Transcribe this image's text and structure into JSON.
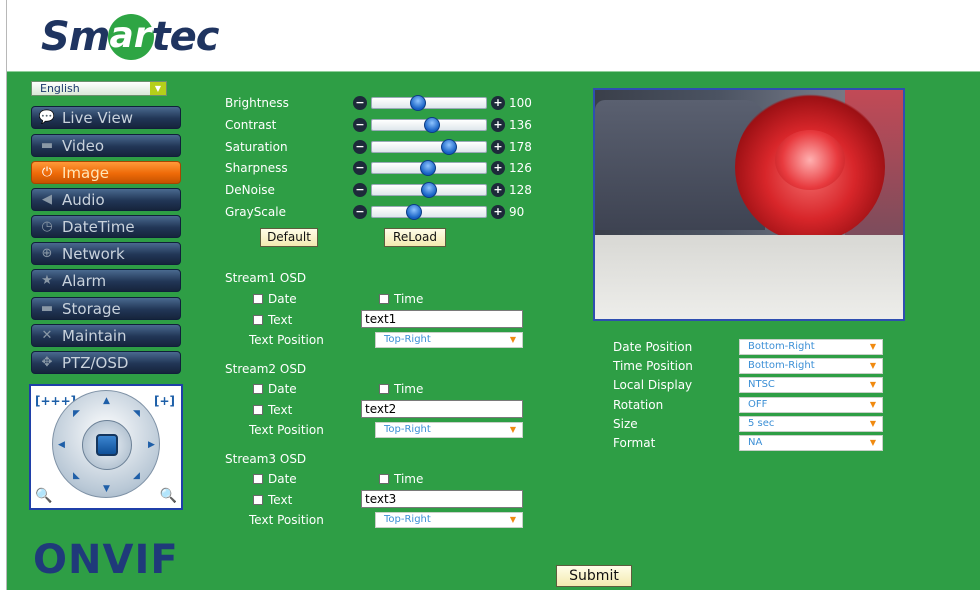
{
  "brand": {
    "logo_pre": "Sm",
    "logo_ball": "ar",
    "logo_post": "tec",
    "onvif": "ONVIF"
  },
  "language": {
    "selected": "English"
  },
  "nav": [
    {
      "label": "Live View",
      "icon": "chat-bubble-icon",
      "active": false
    },
    {
      "label": "Video",
      "icon": "camera-icon",
      "active": false
    },
    {
      "label": "Image",
      "icon": "power-icon",
      "active": true
    },
    {
      "label": "Audio",
      "icon": "speaker-icon",
      "active": false
    },
    {
      "label": "DateTime",
      "icon": "clock-icon",
      "active": false
    },
    {
      "label": "Network",
      "icon": "globe-icon",
      "active": false
    },
    {
      "label": "Alarm",
      "icon": "star-icon",
      "active": false
    },
    {
      "label": "Storage",
      "icon": "drive-icon",
      "active": false
    },
    {
      "label": "Maintain",
      "icon": "tools-icon",
      "active": false
    },
    {
      "label": "PTZ/OSD",
      "icon": "move-arrows-icon",
      "active": false
    }
  ],
  "ptz": {
    "zoom_out": "[+++]",
    "zoom_in": "[+]"
  },
  "image": {
    "sliders": [
      {
        "label": "Brightness",
        "value": "100",
        "level": 0.39
      },
      {
        "label": "Contrast",
        "value": "136",
        "level": 0.53
      },
      {
        "label": "Saturation",
        "value": "178",
        "level": 0.7
      },
      {
        "label": "Sharpness",
        "value": "126",
        "level": 0.49
      },
      {
        "label": "DeNoise",
        "value": "128",
        "level": 0.5
      },
      {
        "label": "GrayScale",
        "value": "90",
        "level": 0.35
      }
    ],
    "default_label": "Default",
    "reload_label": "ReLoad"
  },
  "osd": {
    "streams": [
      {
        "title": "Stream1 OSD",
        "date": "Date",
        "time": "Time",
        "text": "Text",
        "text_value": "text1",
        "pos_label": "Text Position",
        "pos_value": "Top-Right"
      },
      {
        "title": "Stream2 OSD",
        "date": "Date",
        "time": "Time",
        "text": "Text",
        "text_value": "text2",
        "pos_label": "Text Position",
        "pos_value": "Top-Right"
      },
      {
        "title": "Stream3 OSD",
        "date": "Date",
        "time": "Time",
        "text": "Text",
        "text_value": "text3",
        "pos_label": "Text Position",
        "pos_value": "Top-Right"
      }
    ]
  },
  "settings": [
    {
      "label": "Date Position",
      "value": "Bottom-Right"
    },
    {
      "label": "Time Position",
      "value": "Bottom-Right"
    },
    {
      "label": "Local Display",
      "value": "NTSC"
    },
    {
      "label": "Rotation",
      "value": "OFF"
    },
    {
      "label": "Size",
      "value": "5 sec"
    },
    {
      "label": "Format",
      "value": "NA"
    }
  ],
  "submit_label": "Submit",
  "colors": {
    "background": "#2e9e45",
    "active_nav": "#ee6a08",
    "nav": "#213656"
  }
}
